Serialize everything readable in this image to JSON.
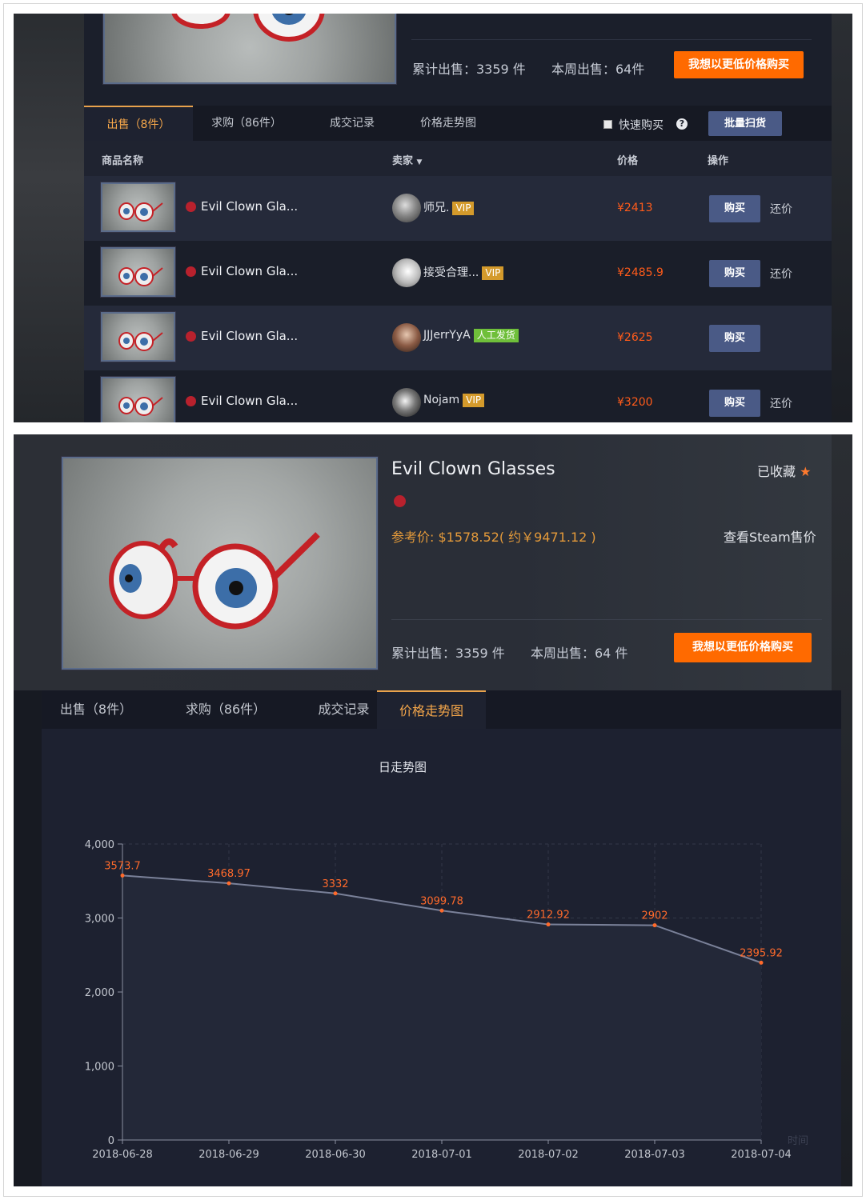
{
  "top": {
    "cumulative_sold_label": "累计出售：3359 件",
    "week_sold_label": "本周出售：64件",
    "buy_cheaper_button": "我想以更低价格购买",
    "tabs": [
      "出售（8件）",
      "求购（86件）",
      "成交记录",
      "价格走势图"
    ],
    "quick_buy_label": "快速购买",
    "batch_sweep_button": "批量扫货",
    "columns": {
      "name": "商品名称",
      "seller": "卖家",
      "price": "价格",
      "action": "操作"
    },
    "rows": [
      {
        "name": "Evil Clown Gla...",
        "seller": "师兄.",
        "badge": "VIP",
        "badge_type": "vip",
        "price": "¥2413",
        "buy": "购买",
        "counter": "还价"
      },
      {
        "name": "Evil Clown Gla...",
        "seller": "接受合理...",
        "badge": "VIP",
        "badge_type": "vip",
        "price": "¥2485.9",
        "buy": "购买",
        "counter": "还价"
      },
      {
        "name": "Evil Clown Gla...",
        "seller": "JJJerrYyA",
        "badge": "人工发货",
        "badge_type": "manual",
        "price": "¥2625",
        "buy": "购买",
        "counter": ""
      },
      {
        "name": "Evil Clown Gla...",
        "seller": "Nojam",
        "badge": "VIP",
        "badge_type": "vip",
        "price": "¥3200",
        "buy": "购买",
        "counter": "还价"
      }
    ]
  },
  "item": {
    "title": "Evil Clown Glasses",
    "favorited_label": "已收藏",
    "ref_price": "参考价: $1578.52( 约￥9471.12 )",
    "steam_price_link": "查看Steam售价",
    "cumulative_sold_label": "累计出售：3359 件",
    "week_sold_label": "本周出售：64 件",
    "buy_cheaper_button": "我想以更低价格购买",
    "tabs": [
      "出售（8件）",
      "求购（86件）",
      "成交记录",
      "价格走势图"
    ]
  },
  "chart_data": {
    "type": "area",
    "title": "日走势图",
    "xlabel": "时间",
    "ylabel": "",
    "x": [
      "2018-06-28",
      "2018-06-29",
      "2018-06-30",
      "2018-07-01",
      "2018-07-02",
      "2018-07-03",
      "2018-07-04"
    ],
    "values": [
      3573.7,
      3468.97,
      3332,
      3099.78,
      2912.92,
      2902,
      2395.92
    ],
    "labels": [
      "3573.7",
      "3468.97",
      "3332",
      "3099.78",
      "2912.92",
      "2902",
      "2395.92"
    ],
    "yticks": [
      "0",
      "1,000",
      "2,000",
      "3,000",
      "4,000"
    ],
    "ylim": [
      0,
      4000
    ],
    "grid": true,
    "colors": {
      "line": "#7a8199",
      "point": "#ff6a2b",
      "label": "#ff6a2b"
    }
  }
}
